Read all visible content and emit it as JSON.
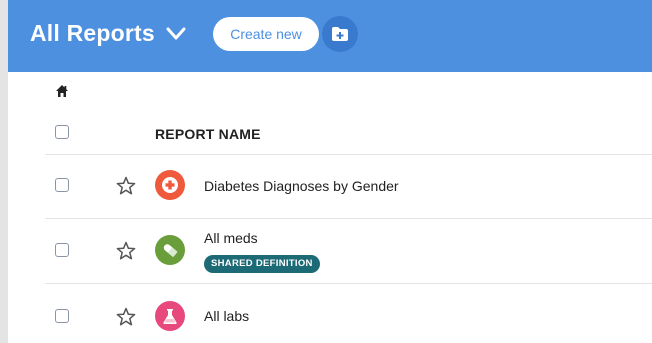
{
  "header": {
    "title": "All Reports",
    "create_label": "Create new",
    "chevron_icon": "chevron-down-icon",
    "folder_icon": "folder-plus-icon",
    "accent_color": "#4d90e0"
  },
  "nav": {
    "home_icon": "home-icon"
  },
  "table": {
    "column_header": "REPORT NAME",
    "rows": [
      {
        "name": "Diabetes Diagnoses by Gender",
        "icon": "medical-cross-icon",
        "icon_color": "#f05a3c",
        "starred": false
      },
      {
        "name": "All meds",
        "icon": "pill-icon",
        "icon_color": "#6a9e3b",
        "badge": "SHARED DEFINITION",
        "badge_color": "#1c6a75",
        "starred": false
      },
      {
        "name": "All labs",
        "icon": "flask-icon",
        "icon_color": "#e8497c",
        "starred": false
      }
    ]
  }
}
